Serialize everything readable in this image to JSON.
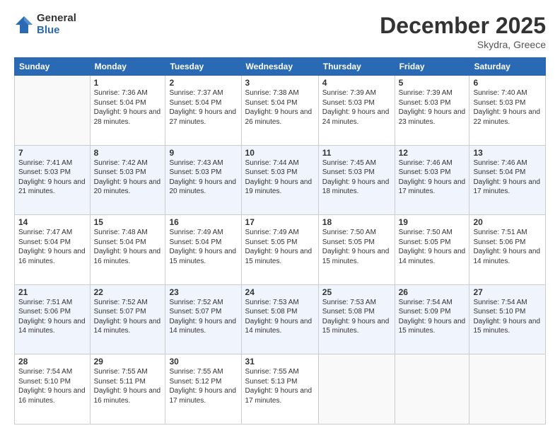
{
  "logo": {
    "general": "General",
    "blue": "Blue"
  },
  "header": {
    "month": "December 2025",
    "location": "Skydra, Greece"
  },
  "weekdays": [
    "Sunday",
    "Monday",
    "Tuesday",
    "Wednesday",
    "Thursday",
    "Friday",
    "Saturday"
  ],
  "weeks": [
    [
      {
        "day": "",
        "sunrise": "",
        "sunset": "",
        "daylight": ""
      },
      {
        "day": "1",
        "sunrise": "Sunrise: 7:36 AM",
        "sunset": "Sunset: 5:04 PM",
        "daylight": "Daylight: 9 hours and 28 minutes."
      },
      {
        "day": "2",
        "sunrise": "Sunrise: 7:37 AM",
        "sunset": "Sunset: 5:04 PM",
        "daylight": "Daylight: 9 hours and 27 minutes."
      },
      {
        "day": "3",
        "sunrise": "Sunrise: 7:38 AM",
        "sunset": "Sunset: 5:04 PM",
        "daylight": "Daylight: 9 hours and 26 minutes."
      },
      {
        "day": "4",
        "sunrise": "Sunrise: 7:39 AM",
        "sunset": "Sunset: 5:03 PM",
        "daylight": "Daylight: 9 hours and 24 minutes."
      },
      {
        "day": "5",
        "sunrise": "Sunrise: 7:39 AM",
        "sunset": "Sunset: 5:03 PM",
        "daylight": "Daylight: 9 hours and 23 minutes."
      },
      {
        "day": "6",
        "sunrise": "Sunrise: 7:40 AM",
        "sunset": "Sunset: 5:03 PM",
        "daylight": "Daylight: 9 hours and 22 minutes."
      }
    ],
    [
      {
        "day": "7",
        "sunrise": "Sunrise: 7:41 AM",
        "sunset": "Sunset: 5:03 PM",
        "daylight": "Daylight: 9 hours and 21 minutes."
      },
      {
        "day": "8",
        "sunrise": "Sunrise: 7:42 AM",
        "sunset": "Sunset: 5:03 PM",
        "daylight": "Daylight: 9 hours and 20 minutes."
      },
      {
        "day": "9",
        "sunrise": "Sunrise: 7:43 AM",
        "sunset": "Sunset: 5:03 PM",
        "daylight": "Daylight: 9 hours and 20 minutes."
      },
      {
        "day": "10",
        "sunrise": "Sunrise: 7:44 AM",
        "sunset": "Sunset: 5:03 PM",
        "daylight": "Daylight: 9 hours and 19 minutes."
      },
      {
        "day": "11",
        "sunrise": "Sunrise: 7:45 AM",
        "sunset": "Sunset: 5:03 PM",
        "daylight": "Daylight: 9 hours and 18 minutes."
      },
      {
        "day": "12",
        "sunrise": "Sunrise: 7:46 AM",
        "sunset": "Sunset: 5:03 PM",
        "daylight": "Daylight: 9 hours and 17 minutes."
      },
      {
        "day": "13",
        "sunrise": "Sunrise: 7:46 AM",
        "sunset": "Sunset: 5:04 PM",
        "daylight": "Daylight: 9 hours and 17 minutes."
      }
    ],
    [
      {
        "day": "14",
        "sunrise": "Sunrise: 7:47 AM",
        "sunset": "Sunset: 5:04 PM",
        "daylight": "Daylight: 9 hours and 16 minutes."
      },
      {
        "day": "15",
        "sunrise": "Sunrise: 7:48 AM",
        "sunset": "Sunset: 5:04 PM",
        "daylight": "Daylight: 9 hours and 16 minutes."
      },
      {
        "day": "16",
        "sunrise": "Sunrise: 7:49 AM",
        "sunset": "Sunset: 5:04 PM",
        "daylight": "Daylight: 9 hours and 15 minutes."
      },
      {
        "day": "17",
        "sunrise": "Sunrise: 7:49 AM",
        "sunset": "Sunset: 5:05 PM",
        "daylight": "Daylight: 9 hours and 15 minutes."
      },
      {
        "day": "18",
        "sunrise": "Sunrise: 7:50 AM",
        "sunset": "Sunset: 5:05 PM",
        "daylight": "Daylight: 9 hours and 15 minutes."
      },
      {
        "day": "19",
        "sunrise": "Sunrise: 7:50 AM",
        "sunset": "Sunset: 5:05 PM",
        "daylight": "Daylight: 9 hours and 14 minutes."
      },
      {
        "day": "20",
        "sunrise": "Sunrise: 7:51 AM",
        "sunset": "Sunset: 5:06 PM",
        "daylight": "Daylight: 9 hours and 14 minutes."
      }
    ],
    [
      {
        "day": "21",
        "sunrise": "Sunrise: 7:51 AM",
        "sunset": "Sunset: 5:06 PM",
        "daylight": "Daylight: 9 hours and 14 minutes."
      },
      {
        "day": "22",
        "sunrise": "Sunrise: 7:52 AM",
        "sunset": "Sunset: 5:07 PM",
        "daylight": "Daylight: 9 hours and 14 minutes."
      },
      {
        "day": "23",
        "sunrise": "Sunrise: 7:52 AM",
        "sunset": "Sunset: 5:07 PM",
        "daylight": "Daylight: 9 hours and 14 minutes."
      },
      {
        "day": "24",
        "sunrise": "Sunrise: 7:53 AM",
        "sunset": "Sunset: 5:08 PM",
        "daylight": "Daylight: 9 hours and 14 minutes."
      },
      {
        "day": "25",
        "sunrise": "Sunrise: 7:53 AM",
        "sunset": "Sunset: 5:08 PM",
        "daylight": "Daylight: 9 hours and 15 minutes."
      },
      {
        "day": "26",
        "sunrise": "Sunrise: 7:54 AM",
        "sunset": "Sunset: 5:09 PM",
        "daylight": "Daylight: 9 hours and 15 minutes."
      },
      {
        "day": "27",
        "sunrise": "Sunrise: 7:54 AM",
        "sunset": "Sunset: 5:10 PM",
        "daylight": "Daylight: 9 hours and 15 minutes."
      }
    ],
    [
      {
        "day": "28",
        "sunrise": "Sunrise: 7:54 AM",
        "sunset": "Sunset: 5:10 PM",
        "daylight": "Daylight: 9 hours and 16 minutes."
      },
      {
        "day": "29",
        "sunrise": "Sunrise: 7:55 AM",
        "sunset": "Sunset: 5:11 PM",
        "daylight": "Daylight: 9 hours and 16 minutes."
      },
      {
        "day": "30",
        "sunrise": "Sunrise: 7:55 AM",
        "sunset": "Sunset: 5:12 PM",
        "daylight": "Daylight: 9 hours and 17 minutes."
      },
      {
        "day": "31",
        "sunrise": "Sunrise: 7:55 AM",
        "sunset": "Sunset: 5:13 PM",
        "daylight": "Daylight: 9 hours and 17 minutes."
      },
      {
        "day": "",
        "sunrise": "",
        "sunset": "",
        "daylight": ""
      },
      {
        "day": "",
        "sunrise": "",
        "sunset": "",
        "daylight": ""
      },
      {
        "day": "",
        "sunrise": "",
        "sunset": "",
        "daylight": ""
      }
    ]
  ]
}
